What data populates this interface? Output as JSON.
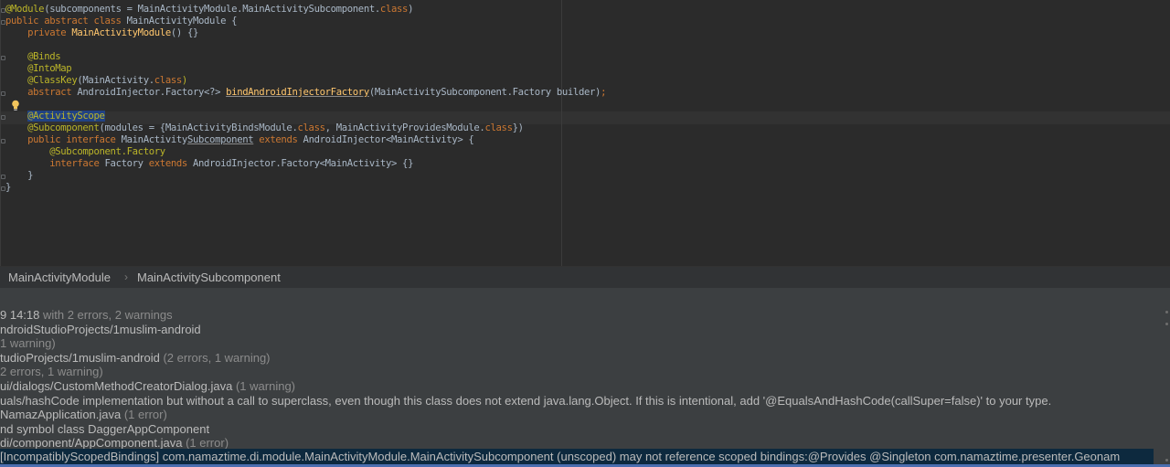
{
  "editor": {
    "lines": [
      [
        {
          "t": "@Module",
          "c": "ann"
        },
        {
          "t": "(subcomponents = MainActivityModule.MainActivitySubcomponent.",
          "c": "plain"
        },
        {
          "t": "class",
          "c": "kw"
        },
        {
          "t": ")",
          "c": "plain"
        }
      ],
      [
        {
          "t": "public abstract class ",
          "c": "kw"
        },
        {
          "t": "MainActivityModule {",
          "c": "plain"
        }
      ],
      [
        {
          "t": "    private ",
          "c": "kw"
        },
        {
          "t": "MainActivityModule",
          "c": "fn"
        },
        {
          "t": "() {}",
          "c": "plain"
        }
      ],
      [],
      [
        {
          "t": "    @Binds",
          "c": "ann"
        }
      ],
      [
        {
          "t": "    @IntoMap",
          "c": "ann"
        }
      ],
      [
        {
          "t": "    @ClassKey",
          "c": "ann"
        },
        {
          "t": "(MainActivity.",
          "c": "plain"
        },
        {
          "t": "class",
          "c": "kw"
        },
        {
          "t": ")",
          "c": "ann"
        }
      ],
      [
        {
          "t": "    abstract ",
          "c": "kw"
        },
        {
          "t": "AndroidInjector.Factory<?> ",
          "c": "plain"
        },
        {
          "t": "bindAndroidInjectorFactory",
          "c": "fn-ul"
        },
        {
          "t": "(MainActivitySubcomponent.Factory builder)",
          "c": "plain"
        },
        {
          "t": ";",
          "c": "kw"
        }
      ],
      [],
      [
        {
          "t": "    ",
          "c": "plain"
        },
        {
          "t": "@ActivityScope",
          "c": "ann-sel"
        }
      ],
      [
        {
          "t": "    @Subcomponent",
          "c": "ann"
        },
        {
          "t": "(modules = {MainActivityBindsModule.",
          "c": "plain"
        },
        {
          "t": "class",
          "c": "kw"
        },
        {
          "t": ", MainActivityProvidesModule.",
          "c": "plain"
        },
        {
          "t": "class",
          "c": "kw"
        },
        {
          "t": "})",
          "c": "plain"
        }
      ],
      [
        {
          "t": "    public interface ",
          "c": "kw"
        },
        {
          "t": "MainActivity",
          "c": "plain"
        },
        {
          "t": "Subcomponent",
          "c": "plain-ul"
        },
        {
          "t": " extends ",
          "c": "kw"
        },
        {
          "t": "AndroidInjector<MainActivity> {",
          "c": "plain"
        }
      ],
      [
        {
          "t": "        @Subcomponent.Factory",
          "c": "ann"
        }
      ],
      [
        {
          "t": "        interface ",
          "c": "kw"
        },
        {
          "t": "Factory ",
          "c": "plain"
        },
        {
          "t": "extends ",
          "c": "kw"
        },
        {
          "t": "AndroidInjector.Factory<MainActivity> {}",
          "c": "plain"
        }
      ],
      [
        {
          "t": "    }",
          "c": "plain"
        }
      ],
      [
        {
          "t": "}",
          "c": "plain"
        }
      ]
    ]
  },
  "breadcrumb": {
    "item1": "MainActivityModule",
    "separator": "›",
    "item2": "MainActivitySubcomponent"
  },
  "output": {
    "rows": [
      {
        "text": "9 14:18",
        "dim": "  with 2 errors, 2 warnings"
      },
      {
        "text": "ndroidStudioProjects/1muslim-android",
        "dim": ""
      },
      {
        "text": "",
        "dim": "1 warning)"
      },
      {
        "text": "tudioProjects/1muslim-android",
        "dim": "  (2 errors, 1 warning)"
      },
      {
        "text": "",
        "dim": "2 errors, 1 warning)"
      },
      {
        "text": "ui/dialogs/CustomMethodCreatorDialog.java",
        "dim": "  (1 warning)"
      },
      {
        "text": "uals/hashCode implementation but without a call to superclass, even though this class does not extend java.lang.Object. If this is intentional, add '@EqualsAndHashCode(callSuper=false)' to your type.",
        "dim": ""
      },
      {
        "text": "NamazApplication.java",
        "dim": "  (1 error)"
      },
      {
        "text": "nd symbol class DaggerAppComponent",
        "dim": ""
      },
      {
        "text": "di/component/AppComponent.java",
        "dim": "  (1 error)"
      }
    ],
    "selected_error": "IncompatiblyScopedBindings] com.namaztime.di.module.MainActivityModule.MainActivitySubcomponent (unscoped) may not reference scoped bindings:@Provides @Singleton com.namaztime.presenter.Geonam"
  }
}
